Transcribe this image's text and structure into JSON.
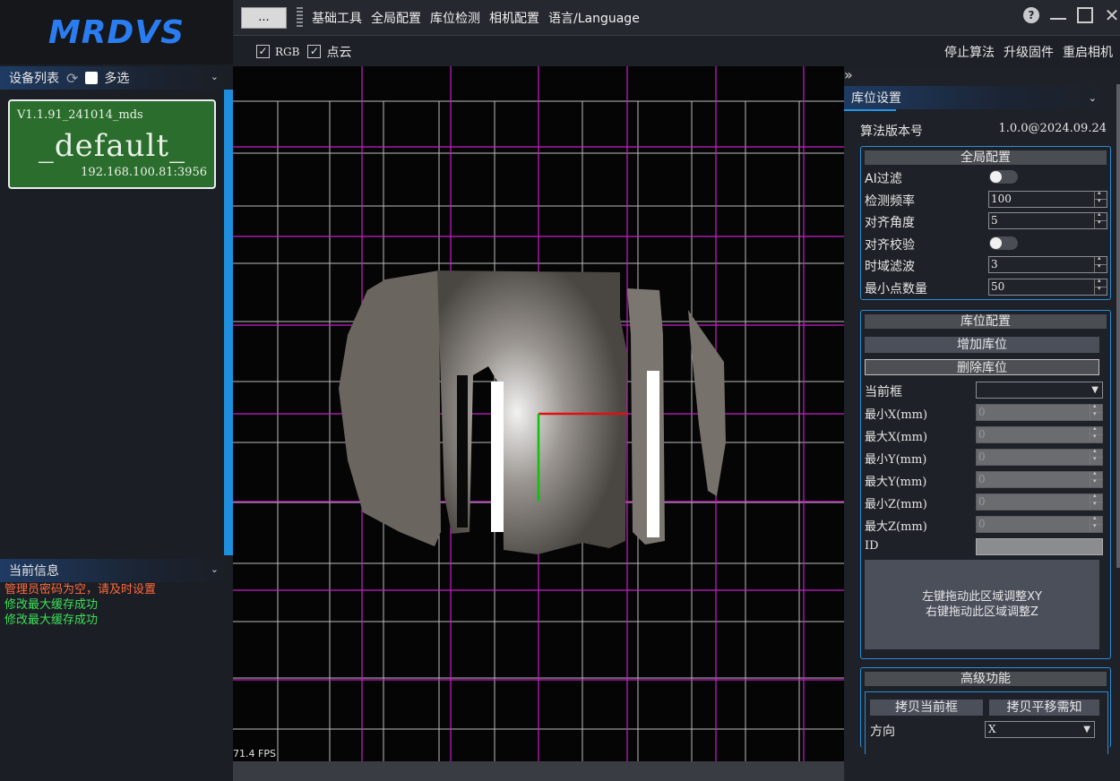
{
  "app": {
    "logo": "MRDVS"
  },
  "device_panel": {
    "title": "设备列表",
    "multi_select_label": "多选",
    "devices": [
      {
        "version": "V1.1.91_241014_mds",
        "name": "_default_",
        "address": "192.168.100.81:3956",
        "color": "#2b6d2c"
      }
    ]
  },
  "info_panel": {
    "title": "当前信息",
    "messages": [
      {
        "text": "管理员密码为空，请及时设置",
        "level": "warning",
        "color": "#ff6a3d"
      },
      {
        "text": "修改最大缓存成功",
        "level": "success",
        "color": "#3de05a"
      },
      {
        "text": "修改最大缓存成功",
        "level": "success",
        "color": "#3de05a"
      }
    ]
  },
  "toolbar": {
    "more_label": "...",
    "menu": [
      "基础工具",
      "全局配置",
      "库位检测",
      "相机配置",
      "语言/Language"
    ]
  },
  "view_options": {
    "rgb": {
      "label": "RGB",
      "checked": true
    },
    "pointcloud": {
      "label": "点云",
      "checked": true
    },
    "actions": [
      "停止算法",
      "升级固件",
      "重启相机"
    ]
  },
  "viewport": {
    "fps": "71.4 FPS"
  },
  "settings": {
    "title": "库位设置",
    "algo_version_label": "算法版本号",
    "algo_version": "1.0.0@2024.09.24",
    "global": {
      "title": "全局配置",
      "ai_filter_label": "AI过滤",
      "ai_filter_on": false,
      "detect_freq_label": "检测频率",
      "detect_freq": "100",
      "align_angle_label": "对齐角度",
      "align_angle": "5",
      "align_check_label": "对齐校验",
      "align_check_on": false,
      "temporal_filter_label": "时域滤波",
      "temporal_filter": "3",
      "min_points_label": "最小点数量",
      "min_points": "50"
    },
    "slots": {
      "title": "库位配置",
      "add_label": "增加库位",
      "delete_label": "删除库位",
      "current_frame_label": "当前框",
      "current_frame": "",
      "min_x_label": "最小X(mm)",
      "min_x": "0",
      "max_x_label": "最大X(mm)",
      "max_x": "0",
      "min_y_label": "最小Y(mm)",
      "min_y": "0",
      "max_y_label": "最大Y(mm)",
      "max_y": "0",
      "min_z_label": "最小Z(mm)",
      "min_z": "0",
      "max_z_label": "最大Z(mm)",
      "max_z": "0",
      "id_label": "ID",
      "id": "",
      "drag_hint_1": "左键拖动此区域调整XY",
      "drag_hint_2": "右键拖动此区域调整Z"
    },
    "advanced": {
      "title": "高级功能",
      "copy_frame_label": "拷贝当前框",
      "copy_shift_label": "拷贝平移需知",
      "direction_label": "方向",
      "direction": "X"
    }
  },
  "colors": {
    "accent": "#2196e6",
    "grid_magenta": "#c81ec8",
    "axis_x": "#e01010",
    "axis_y": "#10c010"
  }
}
